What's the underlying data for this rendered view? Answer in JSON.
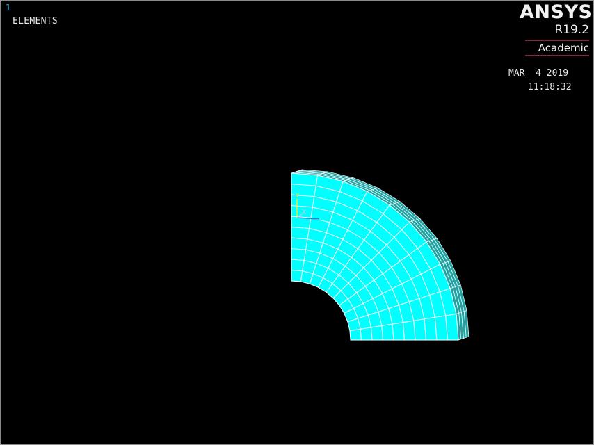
{
  "window": {
    "number": "1"
  },
  "plot": {
    "title": "ELEMENTS"
  },
  "logo": {
    "brand": "ANSYS",
    "version": "R19.2",
    "edition": "Academic"
  },
  "timestamp": {
    "date": "MAR  4 2019",
    "time": "11:18:32"
  },
  "triad": {
    "y_label": "Y",
    "x_label": "X"
  },
  "colors": {
    "background": "#000000",
    "element_face": "#00ffff",
    "element_side": "#1fa3a3",
    "mesh_line": "#ffffff",
    "triad_y": "#e8e83c",
    "triad_x": "#c8c8c8",
    "window_number": "#33c8ff",
    "logo_rule": "#7a2a4a"
  },
  "mesh": {
    "radial_divisions": 10,
    "angular_divisions": 10,
    "thickness_layers": 4
  }
}
